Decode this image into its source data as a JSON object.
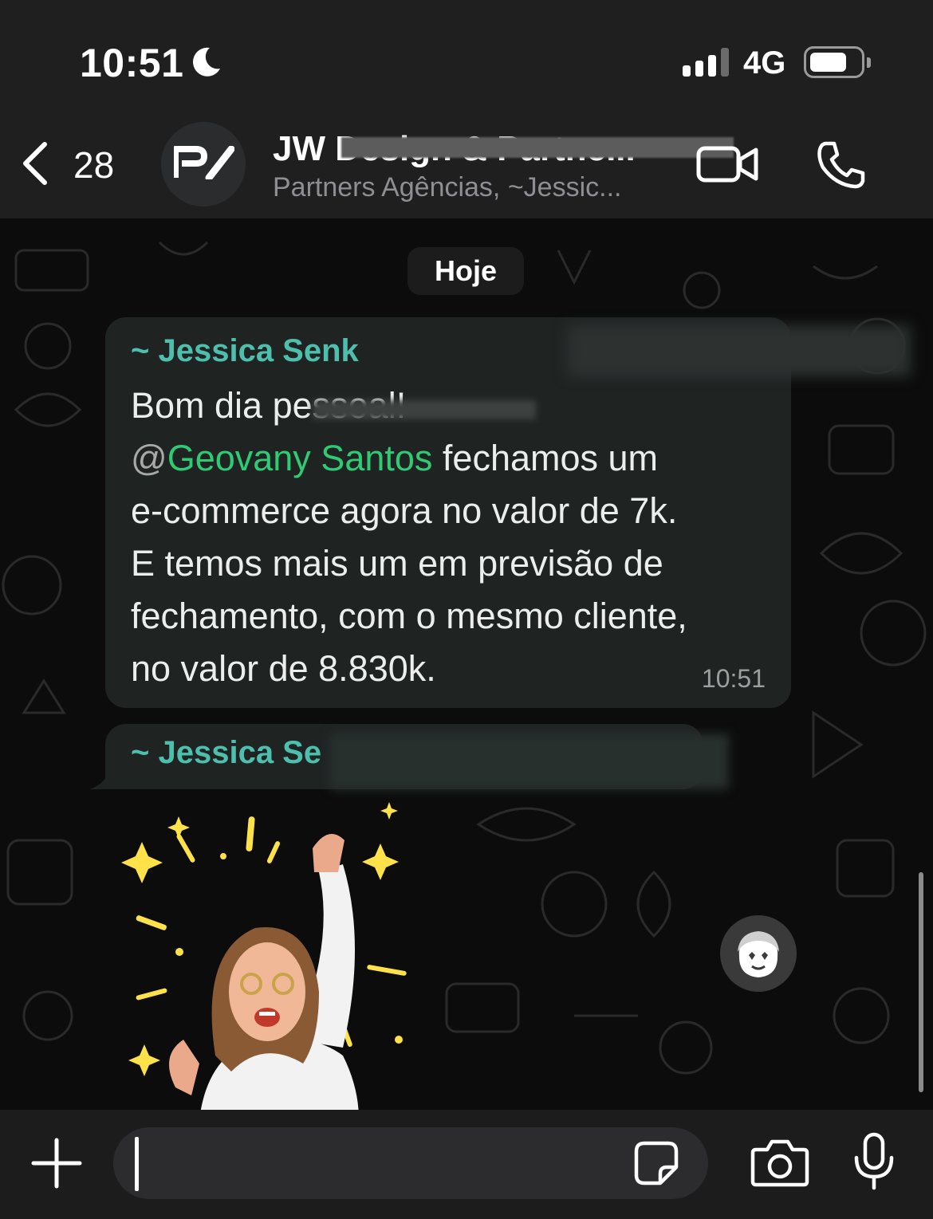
{
  "status_bar": {
    "time": "10:51",
    "moon_icon": "moon-icon",
    "network": "4G",
    "signal_bars_active": 3,
    "signal_bars_total": 4,
    "battery_level": 0.7
  },
  "header": {
    "back_count": "28",
    "title": "JW Design & Partne...",
    "subtitle": "Partners Agências, ~Jessic...",
    "avatar_logo": "P/"
  },
  "chat": {
    "day_label": "Hoje",
    "messages": [
      {
        "sender": "~ Jessica Senk",
        "lines": [
          "Bom dia pessoal!",
          "fechamos um",
          "e-commerce agora no valor de 7k.",
          "E temos mais um em previsão de",
          "fechamento, com o mesmo cliente,",
          "no valor de 8.830k."
        ],
        "mention_at": "@",
        "mention_name": "Geovany Santos",
        "time": "10:51"
      },
      {
        "sender": "~ Jessica Se",
        "sticker": "celebrating-woman-avatar-sticker"
      }
    ]
  },
  "composer": {
    "placeholder": "",
    "value": ""
  },
  "colors": {
    "accent_teal": "#4fbfad",
    "mention_green": "#2fcb74",
    "bubble_bg": "#1f2423",
    "header_bg": "#1f1f1f"
  }
}
